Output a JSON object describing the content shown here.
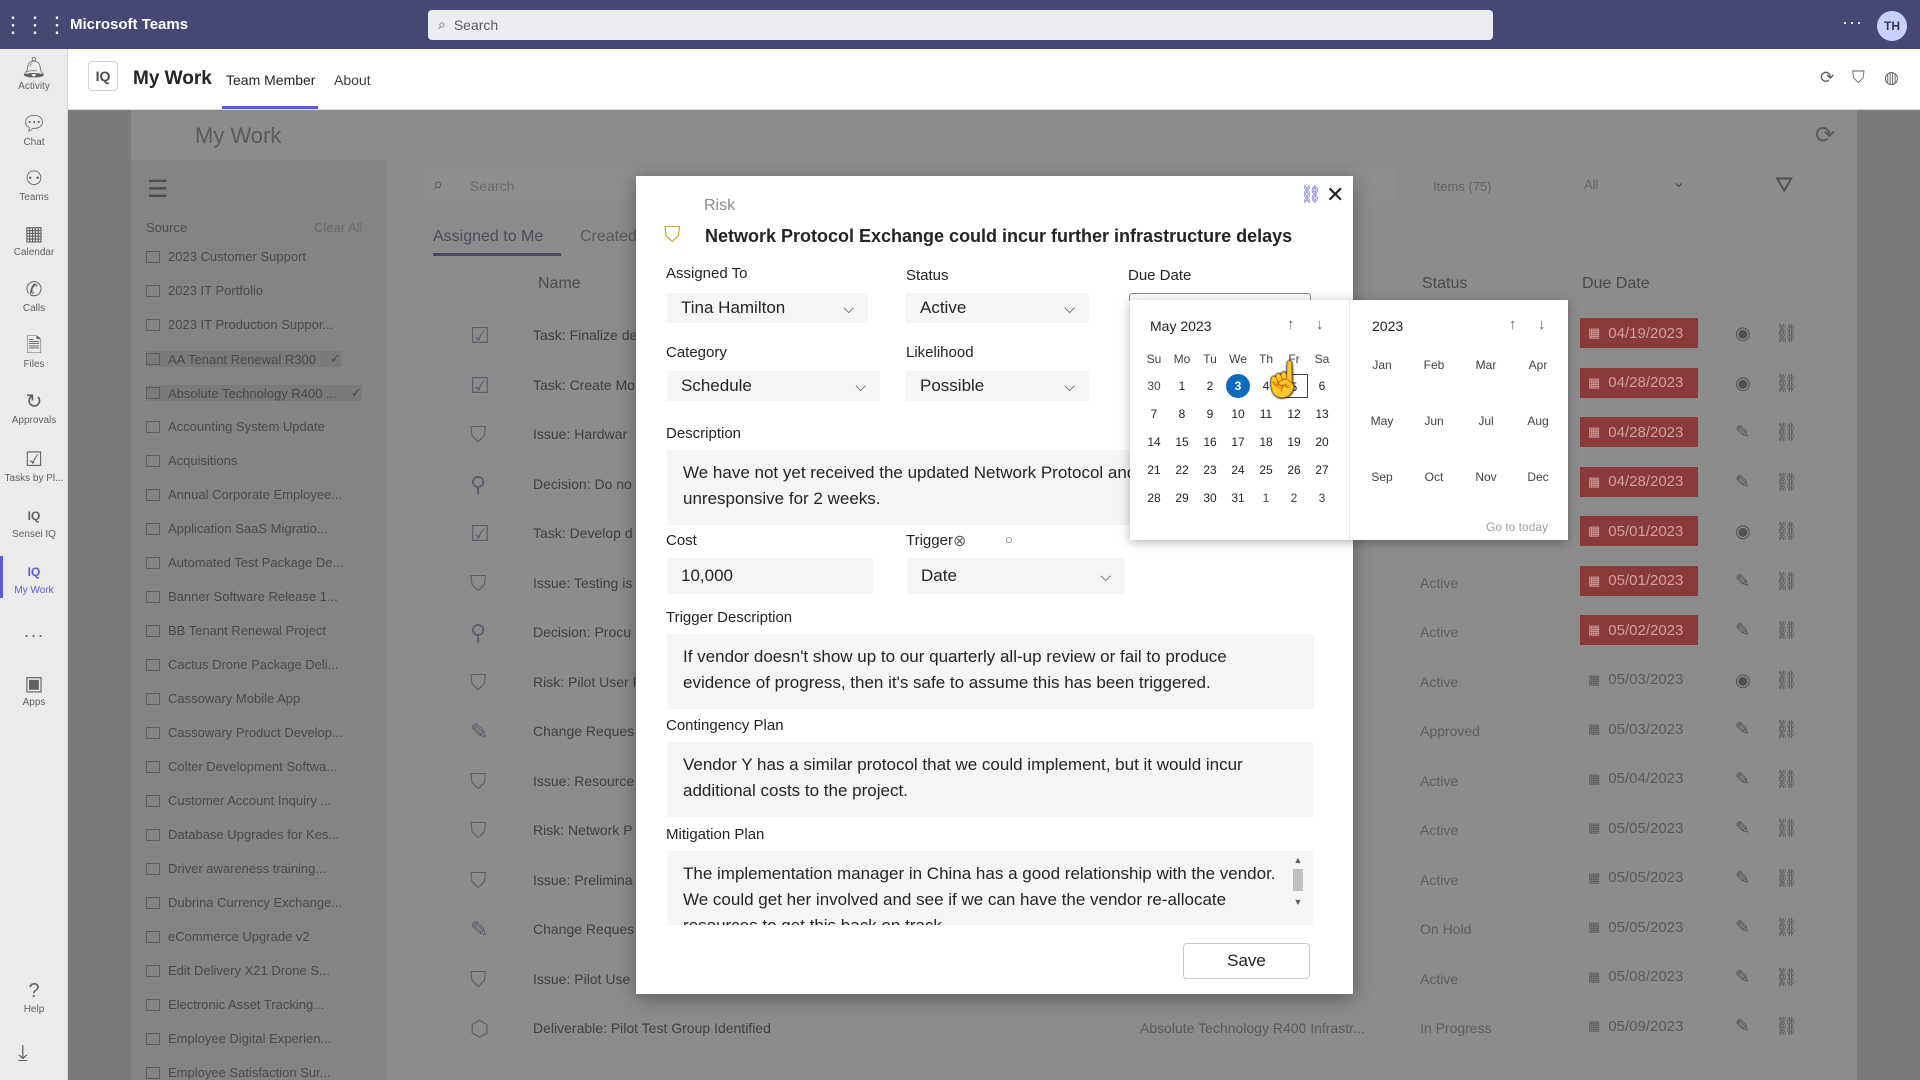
{
  "topbar": {
    "app_title": "Microsoft Teams",
    "search_placeholder": "Search",
    "more": "···",
    "avatar_initials": "TH"
  },
  "rail": {
    "items": [
      {
        "label": "Activity",
        "icon": "bell-icon"
      },
      {
        "label": "Chat",
        "icon": "chat-icon"
      },
      {
        "label": "Teams",
        "icon": "teams-icon"
      },
      {
        "label": "Calendar",
        "icon": "calendar-icon"
      },
      {
        "label": "Calls",
        "icon": "phone-icon"
      },
      {
        "label": "Files",
        "icon": "file-icon"
      },
      {
        "label": "Approvals",
        "icon": "approvals-icon"
      },
      {
        "label": "Tasks by Pl...",
        "icon": "tasks-icon"
      },
      {
        "label": "Sensei IQ",
        "icon": "iq-icon"
      },
      {
        "label": "My Work",
        "icon": "iq-icon"
      },
      {
        "label": "···",
        "icon": "more-icon"
      },
      {
        "label": "Apps",
        "icon": "apps-icon"
      }
    ],
    "help": "Help",
    "active": "My Work"
  },
  "header": {
    "logo": "IQ",
    "app_name": "My Work",
    "tabs": [
      "Team Member",
      "About"
    ]
  },
  "background": {
    "title": "My Work",
    "search_placeholder": "Search",
    "items_count": "Items (75)",
    "filter_all": "All",
    "source_label": "Source",
    "clear_all": "Clear All",
    "sources": [
      "2023 Customer Support",
      "2023 IT Portfolio",
      "2023 IT Production Suppor...",
      "AA Tenant Renewal R300",
      "Absolute Technology R400 ...",
      "Accounting System Update",
      "Acquisitions",
      "Annual Corporate Employee...",
      "Application SaaS Migratio...",
      "Automated Test Package De...",
      "Banner Software Release 1...",
      "BB Tenant Renewal Project",
      "Cactus Drone Package Deli...",
      "Cassowary Mobile App",
      "Cassowary Product Develop...",
      "Colter Development Softwa...",
      "Customer Account Inquiry ...",
      "Database Upgrades for Kes...",
      "Driver awareness training...",
      "Dubrina Currency Exchange...",
      "eCommerce Upgrade v2",
      "Edit Delivery X21 Drone S...",
      "Electronic Asset Tracking...",
      "Employee Digital Experien...",
      "Employee Satisfaction Sur..."
    ],
    "tabs": [
      "Assigned to Me",
      "Created"
    ],
    "columns": [
      "Name",
      "Status",
      "Due Date"
    ],
    "rows": [
      {
        "name": "Task: Finalize de",
        "status": "",
        "due": "04/19/2023",
        "overdue": true
      },
      {
        "name": "Task: Create Mo",
        "status": "",
        "due": "04/28/2023",
        "overdue": true
      },
      {
        "name": "Issue: Hardwar",
        "status": "",
        "due": "04/28/2023",
        "overdue": true
      },
      {
        "name": "Decision: Do no",
        "status": "",
        "due": "04/28/2023",
        "overdue": true
      },
      {
        "name": "Task: Develop d",
        "status": "",
        "due": "05/01/2023",
        "overdue": true
      },
      {
        "name": "Issue: Testing is",
        "status": "Active",
        "due": "05/01/2023",
        "overdue": true
      },
      {
        "name": "Decision: Procu",
        "status": "Active",
        "due": "05/02/2023",
        "overdue": true
      },
      {
        "name": "Risk: Pilot User F",
        "status": "Active",
        "due": "05/03/2023",
        "overdue": false
      },
      {
        "name": "Change Reques",
        "status": "Approved",
        "due": "05/03/2023",
        "overdue": false
      },
      {
        "name": "Issue: Resource",
        "status": "Active",
        "due": "05/04/2023",
        "overdue": false
      },
      {
        "name": "Risk: Network P",
        "status": "Active",
        "due": "05/05/2023",
        "overdue": false
      },
      {
        "name": "Issue: Prelimina",
        "status": "Active",
        "due": "05/05/2023",
        "overdue": false
      },
      {
        "name": "Change Reques",
        "status": "On Hold",
        "due": "05/05/2023",
        "overdue": false
      },
      {
        "name": "Issue: Pilot Use",
        "status": "Active",
        "due": "05/08/2023",
        "overdue": false
      },
      {
        "name": "Deliverable: Pilot Test Group Identified",
        "status": "In Progress",
        "due": "05/09/2023",
        "overdue": false,
        "project": "Absolute Technology R400 Infrastr..."
      }
    ]
  },
  "modal": {
    "type": "Risk",
    "title": "Network Protocol Exchange could incur further infrastructure delays",
    "assigned_to_label": "Assigned To",
    "assigned_to": "Tina Hamilton",
    "status_label": "Status",
    "status": "Active",
    "due_date_label": "Due Date",
    "category_label": "Category",
    "category": "Schedule",
    "likelihood_label": "Likelihood",
    "likelihood": "Possible",
    "description_label": "Description",
    "description": "We have not yet received the updated Network Protocol and vendor has been unresponsive for 2 weeks.",
    "cost_label": "Cost",
    "cost": "10,000",
    "trigger_label": "Trigger",
    "trigger": "Date",
    "trigger_description_label": "Trigger Description",
    "trigger_description": "If vendor doesn't show up to our quarterly all-up review or fail to produce evidence of progress, then it's safe to assume this has been triggered.",
    "contingency_label": "Contingency Plan",
    "contingency": "Vendor Y has a similar protocol that we could implement, but it would incur additional costs to the project.",
    "mitigation_label": "Mitigation Plan",
    "mitigation": "The implementation manager in China has a good relationship with the vendor. We could get her involved and see if we can have the vendor re-allocate resources to get this back on track.",
    "save": "Save"
  },
  "datepicker": {
    "month_title": "May 2023",
    "year_title": "2023",
    "weekdays": [
      "Su",
      "Mo",
      "Tu",
      "We",
      "Th",
      "Fr",
      "Sa"
    ],
    "weeks": [
      [
        "30",
        "1",
        "2",
        "3",
        "4",
        "5",
        "6"
      ],
      [
        "7",
        "8",
        "9",
        "10",
        "11",
        "12",
        "13"
      ],
      [
        "14",
        "15",
        "16",
        "17",
        "18",
        "19",
        "20"
      ],
      [
        "21",
        "22",
        "23",
        "24",
        "25",
        "26",
        "27"
      ],
      [
        "28",
        "29",
        "30",
        "31",
        "1",
        "2",
        "3"
      ]
    ],
    "selected": "3",
    "months": [
      "Jan",
      "Feb",
      "Mar",
      "Apr",
      "May",
      "Jun",
      "Jul",
      "Aug",
      "Sep",
      "Oct",
      "Nov",
      "Dec"
    ],
    "go_to_today": "Go to today"
  }
}
